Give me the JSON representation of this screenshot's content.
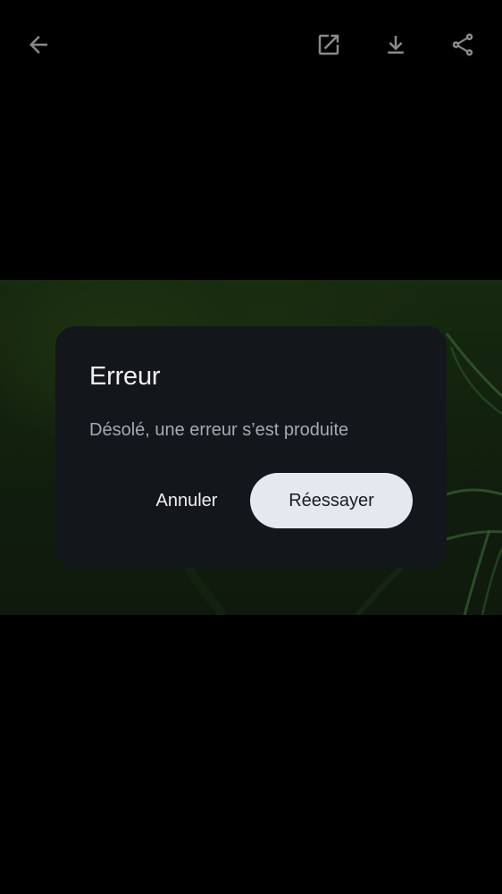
{
  "toolbar": {
    "icons": {
      "back": "arrow-back-icon",
      "open_external": "open-in-new-icon",
      "download": "download-icon",
      "share": "share-icon"
    },
    "icon_color": "#8a8a8a"
  },
  "dialog": {
    "title": "Erreur",
    "message": "Désolé, une erreur s’est produite",
    "cancel_label": "Annuler",
    "retry_label": "Réessayer",
    "background_color": "#13161b",
    "primary_button_color": "#e4e8ef"
  }
}
